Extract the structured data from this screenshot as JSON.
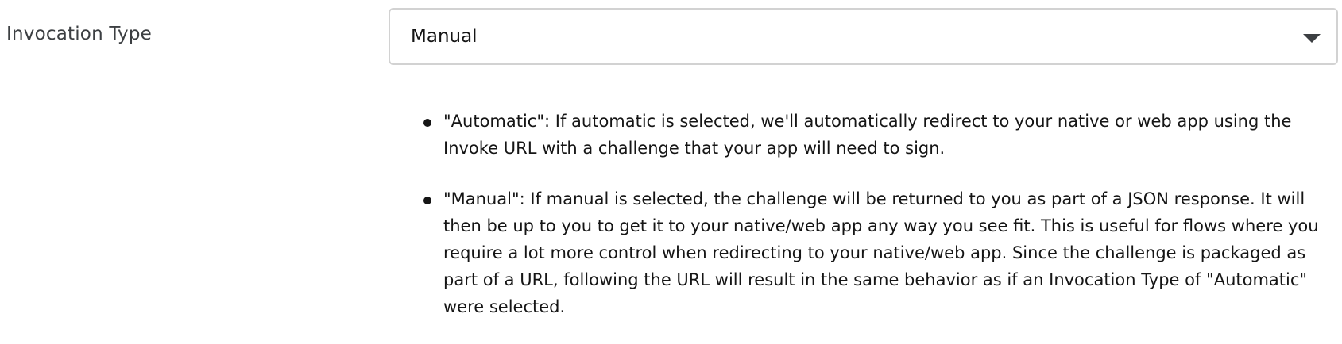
{
  "field": {
    "label": "Invocation Type",
    "selected_value": "Manual",
    "dropdown_icon": "caret-down-icon"
  },
  "help": {
    "items": [
      "\"Automatic\": If automatic is selected, we'll automatically redirect to your native or web app using the Invoke URL with a challenge that your app will need to sign.",
      "\"Manual\": If manual is selected, the challenge will be returned to you as part of a JSON response. It will then be up to you to get it to your native/web app any way you see fit. This is useful for flows where you require a lot more control when redirecting to your native/web app. Since the challenge is packaged as part of a URL, following the URL will result in the same behavior as if an Invocation Type of \"Automatic\" were selected."
    ]
  }
}
